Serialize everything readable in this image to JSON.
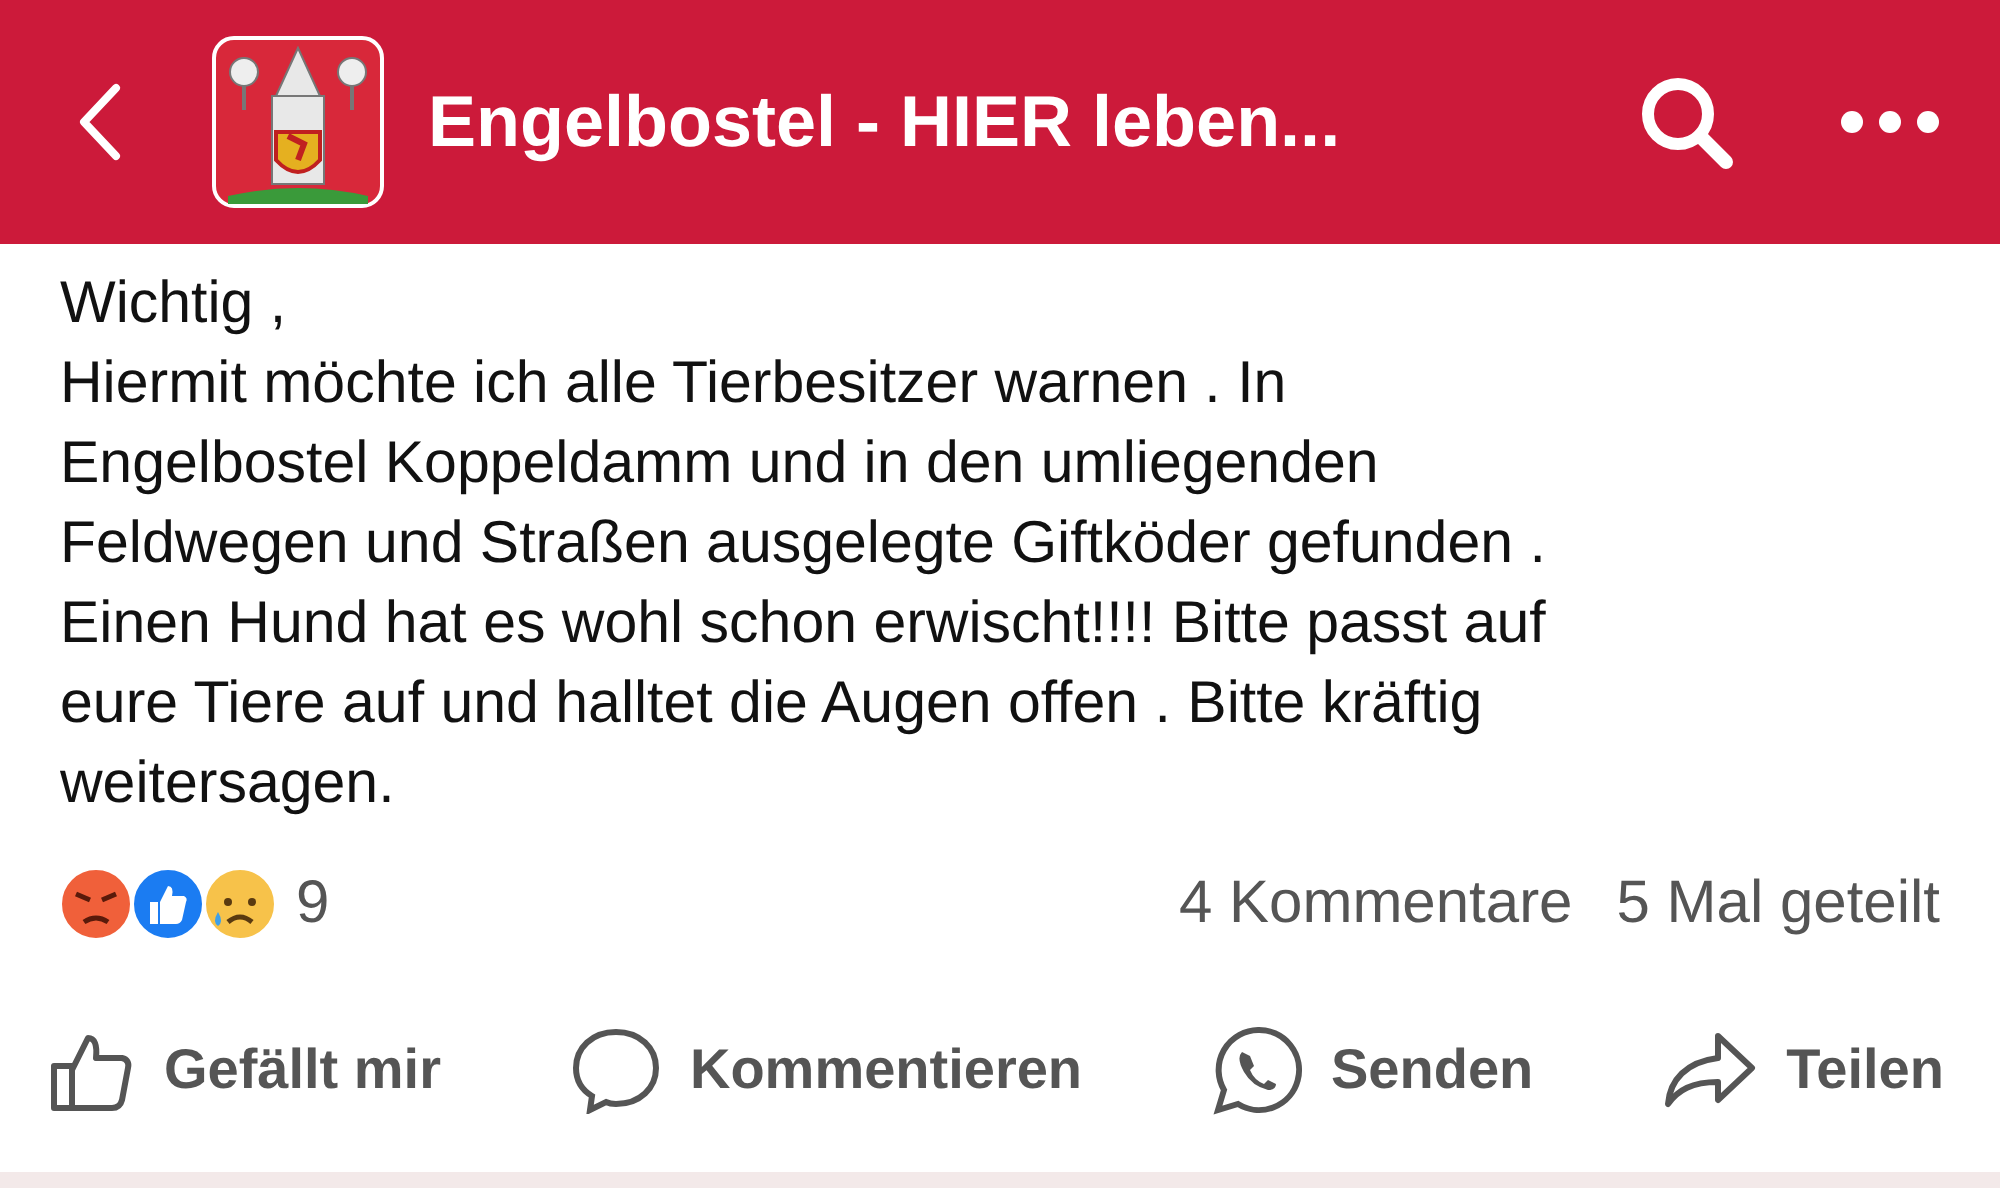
{
  "header": {
    "title": "Engelbostel - HIER leben..."
  },
  "post": {
    "lines": [
      "Wichtig ,",
      "Hiermit möchte ich alle Tierbesitzer warnen . In",
      "Engelbostel Koppeldamm und in den umliegenden",
      "Feldwegen und Straßen ausgelegte Giftköder gefunden .",
      "Einen Hund hat es wohl schon erwischt!!!! Bitte passt auf",
      "eure Tiere auf und halltet die Augen offen . Bitte kräftig",
      "weitersagen."
    ]
  },
  "reactions": {
    "items": [
      {
        "kind": "angry"
      },
      {
        "kind": "like"
      },
      {
        "kind": "sad"
      }
    ],
    "count": "9",
    "comments": "4 Kommentare",
    "shares": "5 Mal geteilt"
  },
  "actions": [
    {
      "kind": "like",
      "label": "Gefällt mir"
    },
    {
      "kind": "comment",
      "label": "Kommentieren"
    },
    {
      "kind": "send",
      "label": "Senden"
    },
    {
      "kind": "share",
      "label": "Teilen"
    }
  ]
}
